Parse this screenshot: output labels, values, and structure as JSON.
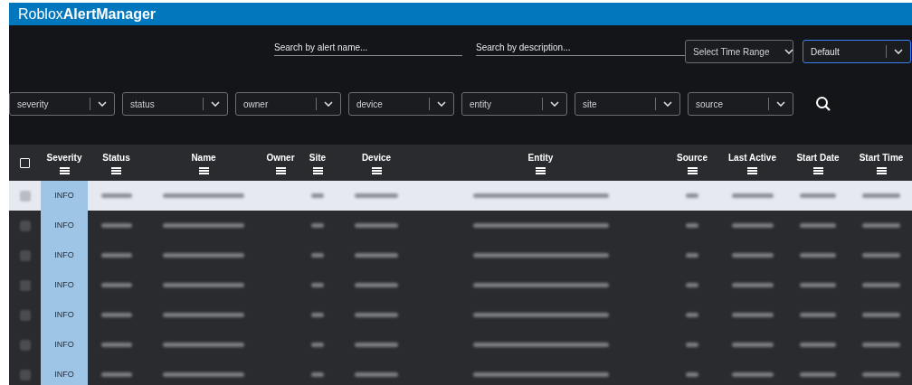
{
  "app_title": {
    "plain": "Roblox",
    "bold": "AlertManager"
  },
  "searches": [
    {
      "placeholder": "Search by alert name..."
    },
    {
      "placeholder": "Search by description..."
    }
  ],
  "time_selects": [
    {
      "placeholder": "Select Time Range",
      "focused": false
    },
    {
      "value": "Default",
      "focused": true
    }
  ],
  "filters": [
    {
      "placeholder": "severity"
    },
    {
      "placeholder": "status"
    },
    {
      "placeholder": "owner"
    },
    {
      "placeholder": "device"
    },
    {
      "placeholder": "entity"
    },
    {
      "placeholder": "site"
    },
    {
      "placeholder": "source"
    }
  ],
  "table": {
    "select_all": {
      "checked": false
    },
    "columns": [
      "Severity",
      "Status",
      "Name",
      "Owner",
      "Site",
      "Device",
      "Entity",
      "Source",
      "Last Active",
      "Start Date",
      "Start Time"
    ],
    "rows": [
      {
        "severity": "INFO",
        "selected": true
      },
      {
        "severity": "INFO",
        "selected": false
      },
      {
        "severity": "INFO",
        "selected": false
      },
      {
        "severity": "INFO",
        "selected": false
      },
      {
        "severity": "INFO",
        "selected": false
      },
      {
        "severity": "INFO",
        "selected": false
      },
      {
        "severity": "INFO",
        "selected": false
      }
    ]
  }
}
